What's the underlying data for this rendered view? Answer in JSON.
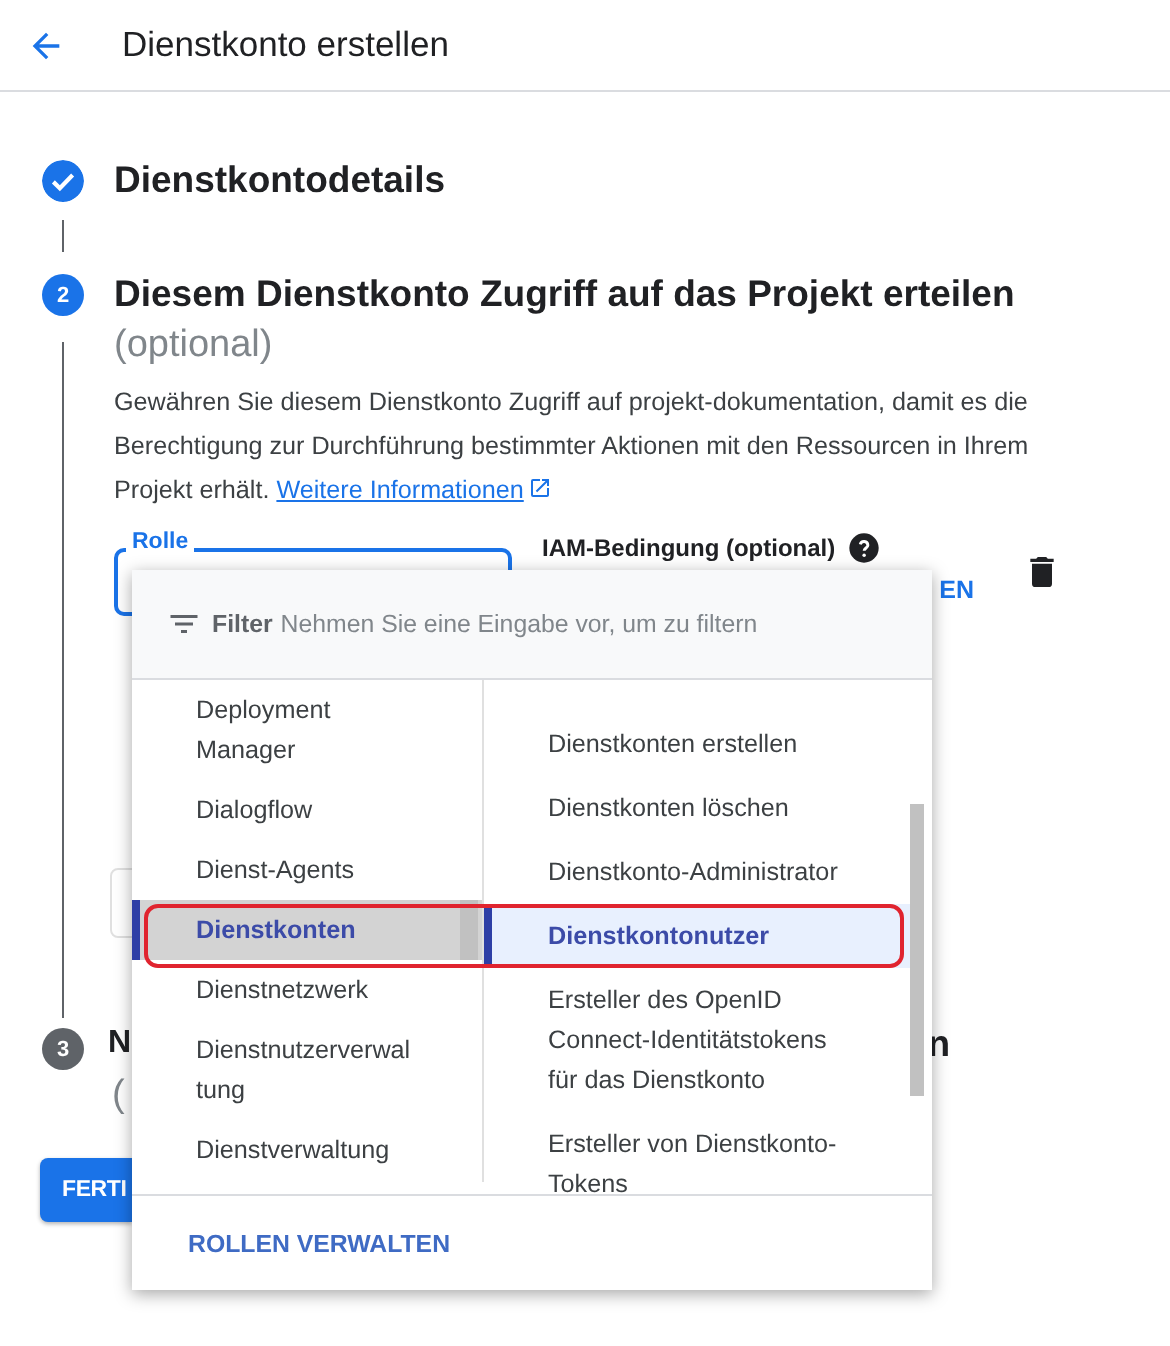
{
  "header": {
    "title": "Dienstkonto erstellen"
  },
  "steps": [
    {
      "kind": "done",
      "title": "Dienstkontodetails"
    },
    {
      "kind": "active",
      "number": "2",
      "title": "Diesem Dienstkonto Zugriff auf das Projekt erteilen",
      "subtitle": "(optional)",
      "description": "Gewähren Sie diesem Dienstkonto Zugriff auf projekt-dokumentation, damit es die Berechtigung zur Durchführung bestimmter Aktionen mit den Ressourcen in Ihrem Projekt erhält.",
      "link": "Weitere Informationen"
    },
    {
      "kind": "pending",
      "number": "3",
      "title_start": "N",
      "title_end": "n",
      "subtitle": "("
    }
  ],
  "role_field": {
    "label": "Rolle",
    "focused": true
  },
  "condition": {
    "label": "IAM-Bedingung (optional)",
    "button": "EN"
  },
  "done_button": "FERTI",
  "role_menu": {
    "filter": {
      "label": "Filter",
      "placeholder": "Nehmen Sie eine Eingabe vor, um zu filtern"
    },
    "services": [
      {
        "label": "Deployment Manager",
        "selected": false
      },
      {
        "label": "Dialogflow",
        "selected": false
      },
      {
        "label": "Dienst-Agents",
        "selected": false
      },
      {
        "label": "Dienstkonten",
        "selected": true
      },
      {
        "label": "Dienstnetzwerk",
        "selected": false
      },
      {
        "label": "Dienstnutzerverwaltung",
        "selected": false
      },
      {
        "label": "Dienstverwaltung",
        "selected": false
      }
    ],
    "roles": [
      {
        "label": "Dienstkonten erstellen",
        "selected": false
      },
      {
        "label": "Dienstkonten löschen",
        "selected": false
      },
      {
        "label": "Dienstkonto-Administrator",
        "selected": false
      },
      {
        "label": "Dienstkontonutzer",
        "selected": true
      },
      {
        "label": "Ersteller des OpenID Connect-Identitätstokens für das Dienstkonto",
        "selected": false
      },
      {
        "label": "Ersteller von Dienstkonto-Tokens",
        "selected": false
      }
    ],
    "highlighted": true,
    "footer_button": "ROLLEN VERWALTEN"
  }
}
